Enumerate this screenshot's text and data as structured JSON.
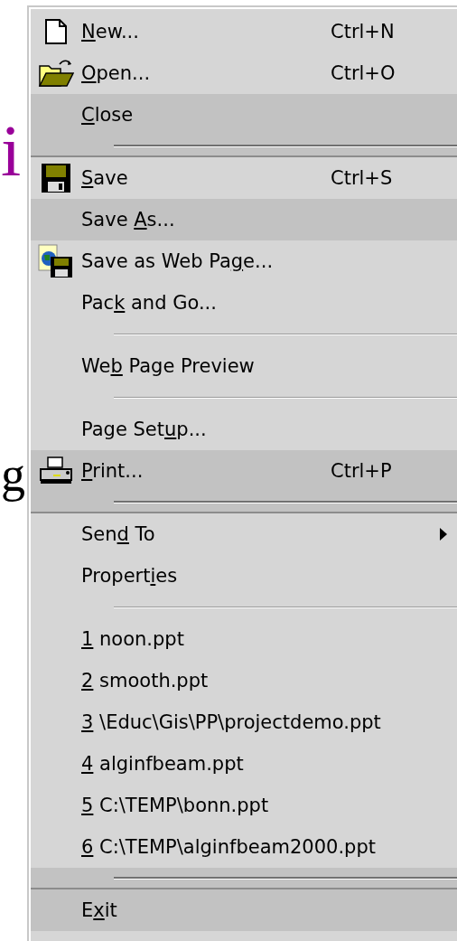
{
  "backdrop_letters": [
    {
      "text": "i",
      "color": "#990099"
    },
    {
      "text": "g",
      "color": "#000000"
    }
  ],
  "menu": {
    "items": [
      {
        "kind": "command",
        "label": {
          "key": "N",
          "post": "ew..."
        },
        "shortcut": "Ctrl+N",
        "has_submenu": false,
        "rarely_used": false
      },
      {
        "kind": "command",
        "label": {
          "key": "O",
          "post": "pen..."
        },
        "shortcut": "Ctrl+O",
        "has_submenu": false,
        "rarely_used": false
      },
      {
        "kind": "command",
        "label": {
          "key": "C",
          "post": "lose"
        },
        "has_submenu": false,
        "rarely_used": true
      },
      {
        "kind": "separator",
        "rarely_used": true
      },
      {
        "kind": "command",
        "label": {
          "key": "S",
          "post": "ave"
        },
        "shortcut": "Ctrl+S",
        "has_submenu": false,
        "rarely_used": false
      },
      {
        "kind": "command",
        "label": {
          "pre": "Save ",
          "key": "A",
          "post": "s..."
        },
        "has_submenu": false,
        "rarely_used": true
      },
      {
        "kind": "command",
        "label": {
          "pre": "Save as Web Pa",
          "key": "g",
          "post": "e..."
        },
        "has_submenu": false,
        "rarely_used": false
      },
      {
        "kind": "command",
        "label": {
          "pre": "Pac",
          "key": "k",
          "post": " and Go..."
        },
        "has_submenu": false,
        "rarely_used": false
      },
      {
        "kind": "separator",
        "rarely_used": false
      },
      {
        "kind": "command",
        "label": {
          "pre": "We",
          "key": "b",
          "post": " Page Preview"
        },
        "has_submenu": false,
        "rarely_used": false
      },
      {
        "kind": "separator",
        "rarely_used": false
      },
      {
        "kind": "command",
        "label": {
          "pre": "Page Set",
          "key": "u",
          "post": "p..."
        },
        "has_submenu": false,
        "rarely_used": false
      },
      {
        "kind": "command",
        "label": {
          "key": "P",
          "post": "rint..."
        },
        "shortcut": "Ctrl+P",
        "has_submenu": false,
        "rarely_used": true
      },
      {
        "kind": "separator",
        "rarely_used": true
      },
      {
        "kind": "command",
        "label": {
          "pre": "Sen",
          "key": "d",
          "post": " To"
        },
        "has_submenu": true,
        "rarely_used": false
      },
      {
        "kind": "command",
        "label": {
          "pre": "Propert",
          "key": "i",
          "post": "es"
        },
        "has_submenu": false,
        "rarely_used": false
      },
      {
        "kind": "separator",
        "rarely_used": false
      },
      {
        "kind": "command",
        "label": {
          "key": "1",
          "post": " noon.ppt"
        },
        "has_submenu": false,
        "rarely_used": false
      },
      {
        "kind": "command",
        "label": {
          "key": "2",
          "post": " smooth.ppt"
        },
        "has_submenu": false,
        "rarely_used": false
      },
      {
        "kind": "command",
        "label": {
          "key": "3",
          "post": " \\Educ\\Gis\\PP\\projectdemo.ppt"
        },
        "has_submenu": false,
        "rarely_used": false
      },
      {
        "kind": "command",
        "label": {
          "key": "4",
          "post": " alginfbeam.ppt"
        },
        "has_submenu": false,
        "rarely_used": false
      },
      {
        "kind": "command",
        "label": {
          "key": "5",
          "post": " C:\\TEMP\\bonn.ppt"
        },
        "has_submenu": false,
        "rarely_used": false
      },
      {
        "kind": "command",
        "label": {
          "key": "6",
          "post": " C:\\TEMP\\alginfbeam2000.ppt"
        },
        "has_submenu": false,
        "rarely_used": false
      },
      {
        "kind": "separator",
        "rarely_used": true
      },
      {
        "kind": "command",
        "label": {
          "pre": "E",
          "key": "x",
          "post": "it"
        },
        "has_submenu": false,
        "rarely_used": true
      }
    ]
  }
}
